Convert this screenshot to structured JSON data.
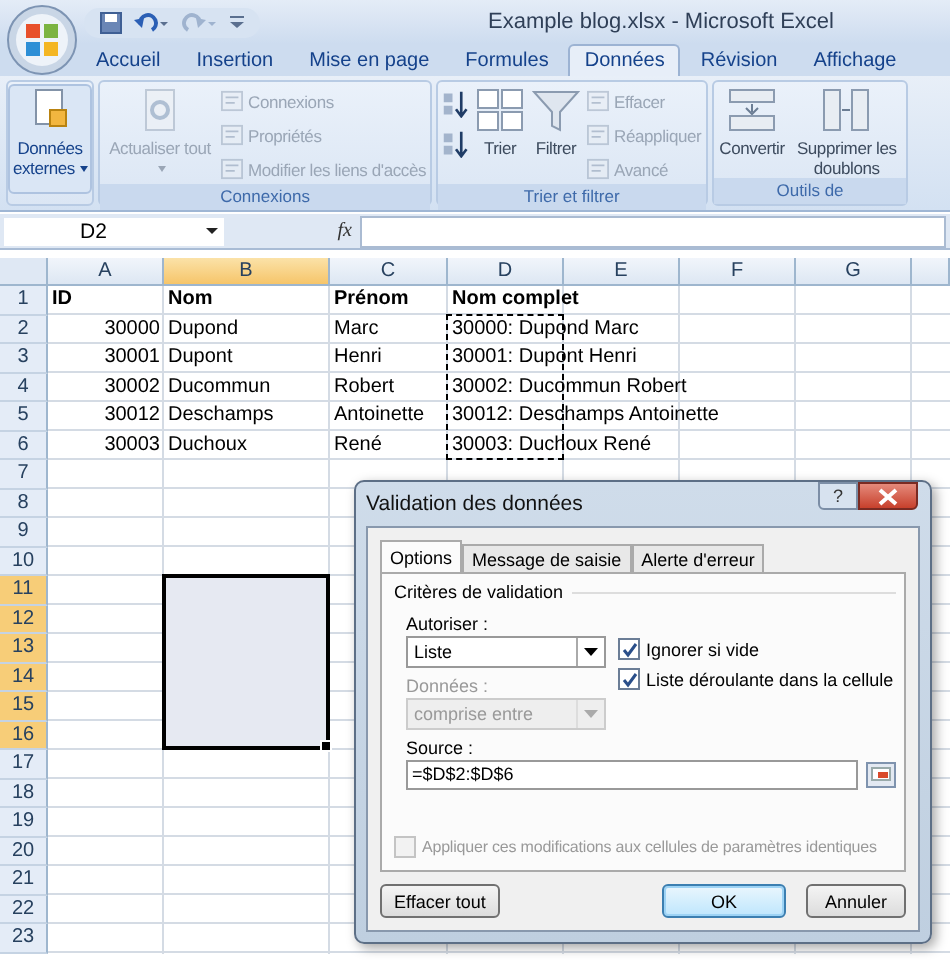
{
  "window": {
    "title": "Example blog.xlsx - Microsoft Excel"
  },
  "ribbon_tabs": [
    {
      "label": "Accueil",
      "selected": false
    },
    {
      "label": "Insertion",
      "selected": false
    },
    {
      "label": "Mise en page",
      "selected": false
    },
    {
      "label": "Formules",
      "selected": false
    },
    {
      "label": "Données",
      "selected": true
    },
    {
      "label": "Révision",
      "selected": false
    },
    {
      "label": "Affichage",
      "selected": false
    }
  ],
  "ribbon_groups": [
    {
      "items": [
        {
          "kind": "large",
          "label": "Données externes",
          "dropdown": true,
          "disabled": false
        }
      ]
    },
    {
      "label": "Connexions",
      "items": [
        {
          "kind": "large",
          "label": "Actualiser tout",
          "dropdown": true,
          "disabled": true
        },
        {
          "kind": "small",
          "label": "Connexions",
          "disabled": true
        },
        {
          "kind": "small",
          "label": "Propriétés",
          "disabled": true
        },
        {
          "kind": "small",
          "label": "Modifier les liens d'accès",
          "disabled": true
        }
      ]
    },
    {
      "label": "Trier et filtrer",
      "items": [
        {
          "kind": "pair",
          "disabled": false
        },
        {
          "kind": "large",
          "label": "Trier",
          "disabled": false
        },
        {
          "kind": "large",
          "label": "Filtrer",
          "disabled": false
        },
        {
          "kind": "small",
          "label": "Effacer",
          "disabled": true
        },
        {
          "kind": "small",
          "label": "Réappliquer",
          "disabled": true
        },
        {
          "kind": "small",
          "label": "Avancé",
          "disabled": true
        }
      ]
    },
    {
      "label": "Outils de",
      "items": [
        {
          "kind": "large",
          "label": "Convertir",
          "disabled": false
        },
        {
          "kind": "large",
          "label": "Supprimer les doublons",
          "disabled": false
        }
      ]
    }
  ],
  "formula_bar": {
    "name_box": "D2",
    "fx": "fx"
  },
  "columns": [
    {
      "label": "A",
      "selected": false,
      "marquee": false
    },
    {
      "label": "B",
      "selected": true,
      "marquee": false
    },
    {
      "label": "C",
      "selected": false,
      "marquee": false
    },
    {
      "label": "D",
      "selected": false,
      "marquee": true
    },
    {
      "label": "E",
      "selected": false,
      "marquee": false
    },
    {
      "label": "F",
      "selected": false,
      "marquee": false
    },
    {
      "label": "G",
      "selected": false,
      "marquee": false
    }
  ],
  "rows": [
    {
      "label": "1",
      "selected": false,
      "marquee": false,
      "cells": [
        {
          "text": "ID",
          "kind": "header"
        },
        {
          "text": "Nom",
          "kind": "header"
        },
        {
          "text": "Prénom",
          "kind": "header"
        },
        {
          "text": "Nom complet",
          "kind": "header"
        }
      ]
    },
    {
      "label": "2",
      "selected": false,
      "marquee": true,
      "cells": [
        {
          "text": "30000",
          "kind": "number"
        },
        {
          "text": "Dupond",
          "kind": "text"
        },
        {
          "text": "Marc",
          "kind": "text"
        },
        {
          "text": "30000: Dupond Marc",
          "kind": "text"
        }
      ]
    },
    {
      "label": "3",
      "selected": false,
      "marquee": true,
      "cells": [
        {
          "text": "30001",
          "kind": "number"
        },
        {
          "text": "Dupont",
          "kind": "text"
        },
        {
          "text": "Henri",
          "kind": "text"
        },
        {
          "text": "30001: Dupont Henri",
          "kind": "text"
        }
      ]
    },
    {
      "label": "4",
      "selected": false,
      "marquee": true,
      "cells": [
        {
          "text": "30002",
          "kind": "number"
        },
        {
          "text": "Ducommun",
          "kind": "text"
        },
        {
          "text": "Robert",
          "kind": "text"
        },
        {
          "text": "30002: Ducommun Robert",
          "kind": "text"
        }
      ]
    },
    {
      "label": "5",
      "selected": false,
      "marquee": true,
      "cells": [
        {
          "text": "30012",
          "kind": "number"
        },
        {
          "text": "Deschamps",
          "kind": "text"
        },
        {
          "text": "Antoinette",
          "kind": "text"
        },
        {
          "text": "30012: Deschamps Antoinette",
          "kind": "text"
        }
      ]
    },
    {
      "label": "6",
      "selected": false,
      "marquee": true,
      "cells": [
        {
          "text": "30003",
          "kind": "number"
        },
        {
          "text": "Duchoux",
          "kind": "text"
        },
        {
          "text": "René",
          "kind": "text"
        },
        {
          "text": "30003: Duchoux René",
          "kind": "text"
        }
      ]
    },
    {
      "label": "7",
      "selected": false,
      "marquee": false
    },
    {
      "label": "8",
      "selected": false,
      "marquee": false
    },
    {
      "label": "9",
      "selected": false,
      "marquee": false
    },
    {
      "label": "10",
      "selected": false,
      "marquee": false
    },
    {
      "label": "11",
      "selected": true,
      "marquee": false
    },
    {
      "label": "12",
      "selected": true,
      "marquee": false
    },
    {
      "label": "13",
      "selected": true,
      "marquee": false
    },
    {
      "label": "14",
      "selected": true,
      "marquee": false
    },
    {
      "label": "15",
      "selected": true,
      "marquee": false
    },
    {
      "label": "16",
      "selected": true,
      "marquee": false
    },
    {
      "label": "17",
      "selected": false,
      "marquee": false
    },
    {
      "label": "18",
      "selected": false,
      "marquee": false
    },
    {
      "label": "19",
      "selected": false,
      "marquee": false
    },
    {
      "label": "20",
      "selected": false,
      "marquee": false
    },
    {
      "label": "21",
      "selected": false,
      "marquee": false
    },
    {
      "label": "22",
      "selected": false,
      "marquee": false
    },
    {
      "label": "23",
      "selected": false,
      "marquee": false
    }
  ],
  "dialog": {
    "title": "Validation des données",
    "help": "?",
    "tabs": [
      {
        "label": "Options",
        "selected": true
      },
      {
        "label": "Message de saisie",
        "selected": false
      },
      {
        "label": "Alerte d'erreur",
        "selected": false
      }
    ],
    "group_label": "Critères de validation",
    "allow": {
      "label": "Autoriser :",
      "value": "Liste",
      "disabled": false
    },
    "data": {
      "label": "Données :",
      "value": "comprise entre",
      "disabled": true
    },
    "checkboxes": [
      {
        "label": "Ignorer si vide",
        "checked": true,
        "disabled": false
      },
      {
        "label": "Liste déroulante dans la cellule",
        "checked": true,
        "disabled": false
      }
    ],
    "source": {
      "label": "Source :",
      "value": "=$D$2:$D$6"
    },
    "apply_all": {
      "label": "Appliquer ces modifications aux cellules de paramètres identiques",
      "checked": false,
      "disabled": true
    },
    "buttons": [
      {
        "label": "Effacer tout",
        "default": false,
        "kind": "left"
      },
      {
        "label": "OK",
        "default": true,
        "kind": "right"
      },
      {
        "label": "Annuler",
        "default": false,
        "kind": "right"
      }
    ]
  }
}
